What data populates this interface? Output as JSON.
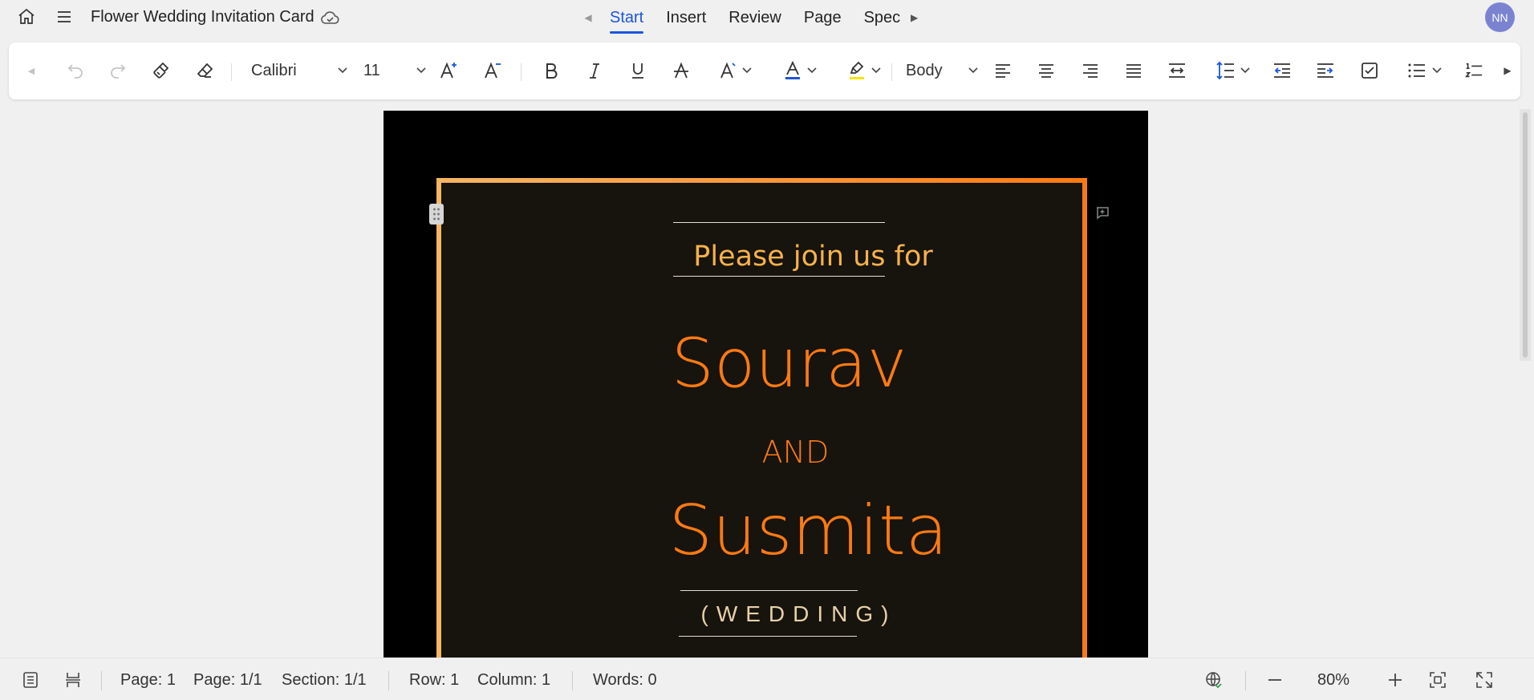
{
  "app": {
    "doc_title": "Flower Wedding Invitation Card",
    "avatar_initials": "NN"
  },
  "tabs": [
    {
      "label": "Start",
      "active": true
    },
    {
      "label": "Insert",
      "active": false
    },
    {
      "label": "Review",
      "active": false
    },
    {
      "label": "Page",
      "active": false
    },
    {
      "label": "Special",
      "active": false
    }
  ],
  "toolbar": {
    "font_family": "Calibri",
    "font_size": "11",
    "paragraph_style": "Body",
    "font_color": "#1a56db",
    "highlight_color": "#f5e400"
  },
  "document": {
    "subtitle": "Please join us for",
    "name1": "Sourav",
    "connector": "AND",
    "name2": "Susmita",
    "event": "(WEDDING)"
  },
  "status": {
    "page": "Page: 1",
    "page_total": "Page: 1/1",
    "section": "Section: 1/1",
    "row": "Row: 1",
    "column": "Column: 1",
    "words": "Words: 0",
    "zoom": "80%"
  },
  "colors": {
    "accent": "#1a56db",
    "name_orange": "#fb7a12",
    "subtitle_gold": "#f6b24a",
    "card_bg": "#17130d"
  }
}
